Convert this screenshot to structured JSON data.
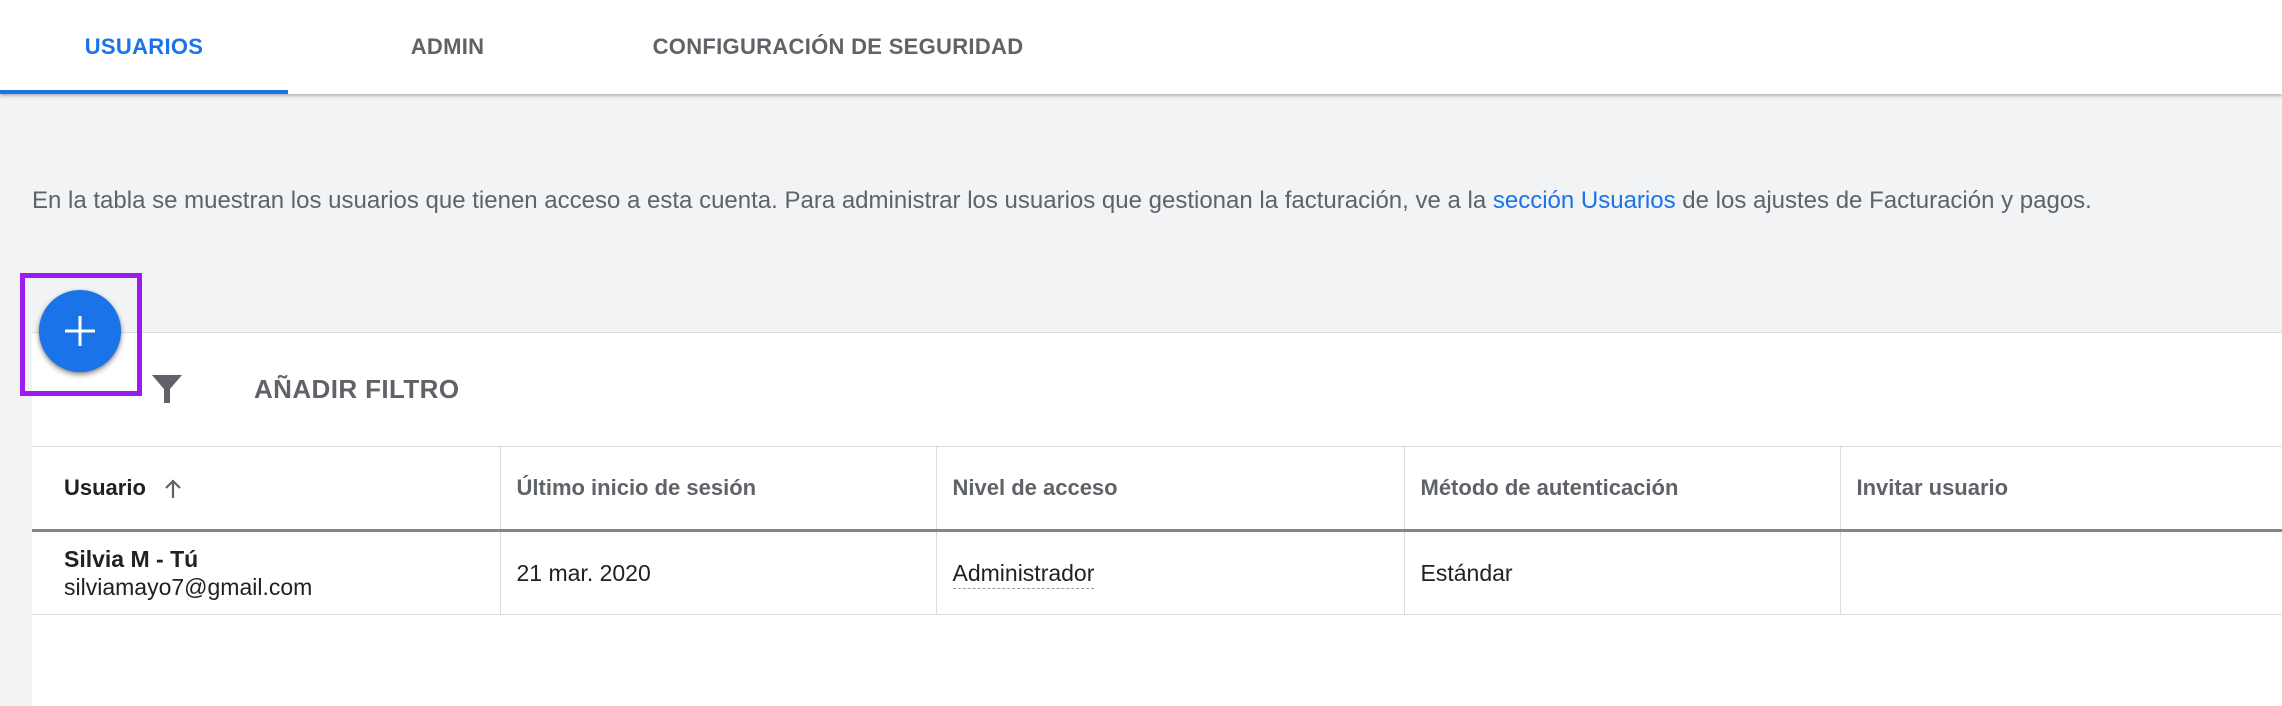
{
  "tabs": [
    {
      "label": "USUARIOS",
      "active": true
    },
    {
      "label": "ADMIN",
      "active": false
    },
    {
      "label": "CONFIGURACIÓN DE SEGURIDAD",
      "active": false
    }
  ],
  "description": {
    "before": "En la tabla se muestran los usuarios que tienen acceso a esta cuenta. Para administrar los usuarios que gestionan la facturación, ve a la ",
    "link": "sección Usuarios",
    "after": " de los ajustes de Facturación y pagos."
  },
  "toolbar": {
    "add_button_icon": "plus-icon",
    "filter_icon": "filter-icon",
    "filter_label": "AÑADIR FILTRO"
  },
  "table": {
    "columns": [
      "Usuario",
      "Último inicio de sesión",
      "Nivel de acceso",
      "Método de autenticación",
      "Invitar usuario"
    ],
    "sort_icon": "arrow-up-icon",
    "rows": [
      {
        "name": "Silvia M - Tú",
        "email": "silviamayo7@gmail.com",
        "last_login": "21 mar. 2020",
        "access_level": "Administrador",
        "auth_method": "Estándar",
        "invite": ""
      }
    ]
  },
  "colors": {
    "accent": "#1a73e8",
    "highlight": "#9b1bf0",
    "background": "#f1f3f4"
  }
}
